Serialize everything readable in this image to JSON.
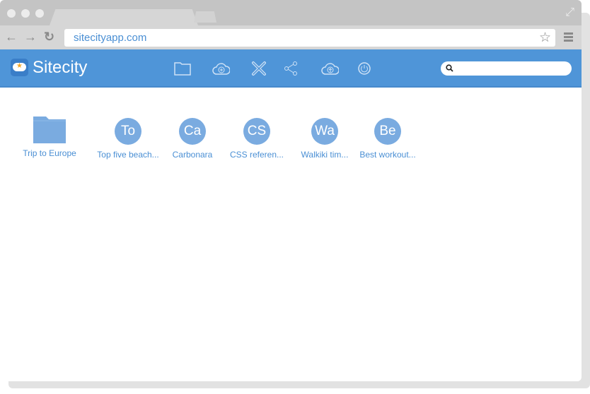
{
  "browser": {
    "url": "sitecityapp.com"
  },
  "app": {
    "brand": "Sitecity",
    "search_placeholder": "",
    "accent": "#4f95d8"
  },
  "toolbar_icons": [
    "folder-icon",
    "cloud-add-icon",
    "close-icon",
    "share-icon",
    "cloud-upload-icon",
    "power-icon"
  ],
  "items": [
    {
      "type": "folder",
      "label": "Trip to Europe"
    },
    {
      "type": "doc",
      "initials": "To",
      "label": "Top five beach..."
    },
    {
      "type": "doc",
      "initials": "Ca",
      "label": "Carbonara"
    },
    {
      "type": "doc",
      "initials": "CS",
      "label": "CSS referen..."
    },
    {
      "type": "doc",
      "initials": "Wa",
      "label": "Walkiki tim..."
    },
    {
      "type": "doc",
      "initials": "Be",
      "label": "Best workout..."
    }
  ]
}
